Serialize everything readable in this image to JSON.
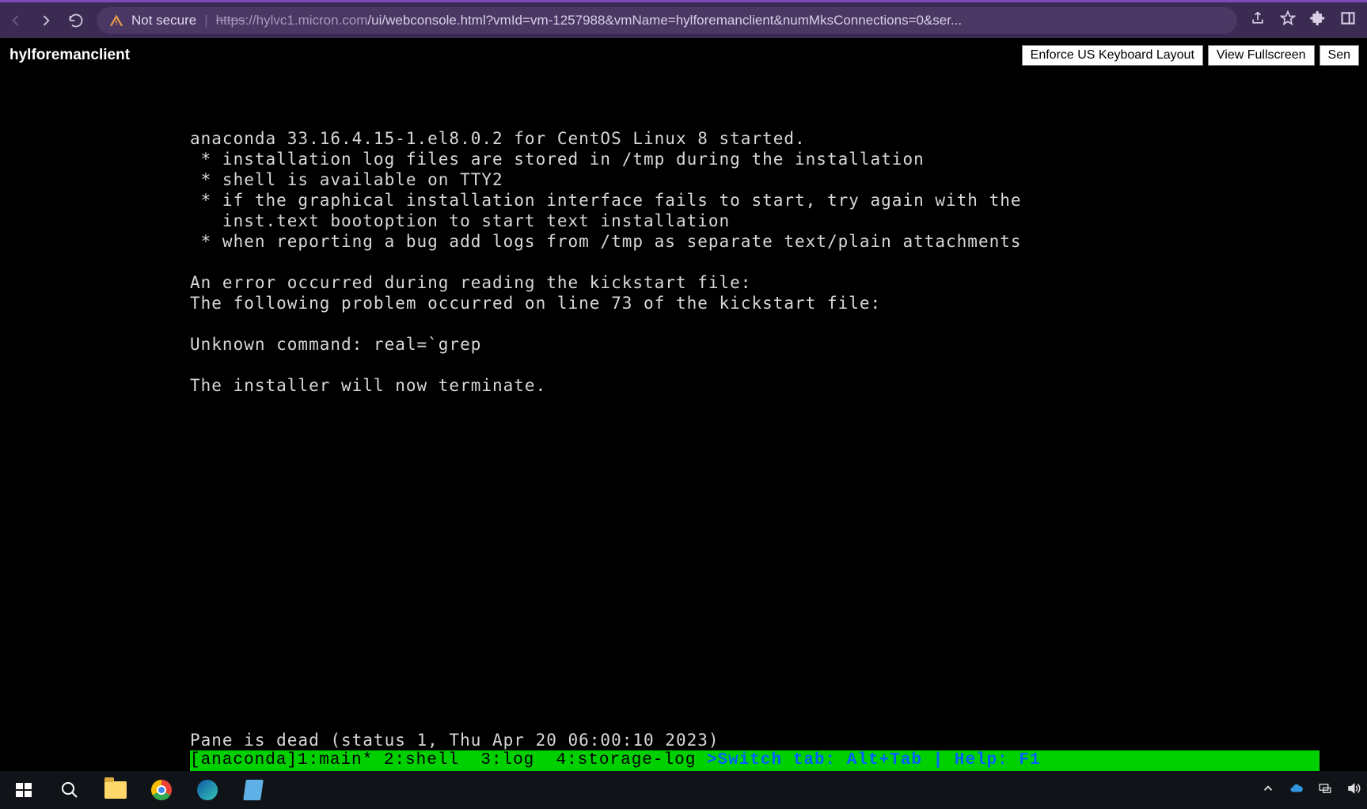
{
  "browser": {
    "not_secure": "Not secure",
    "url_proto": "https",
    "url_sep": "://",
    "url_host_dim": "hylvc1.micron.com",
    "url_path": "/ui/webconsole.html?vmId=vm-1257988&vmName=hylforemanclient&numMksConnections=0&ser..."
  },
  "page": {
    "title": "hylforemanclient",
    "buttons": {
      "kbd": "Enforce US Keyboard Layout",
      "fs": "View Fullscreen",
      "send": "Sen"
    }
  },
  "console": {
    "lines": [
      "anaconda 33.16.4.15-1.el8.0.2 for CentOS Linux 8 started.",
      " * installation log files are stored in /tmp during the installation",
      " * shell is available on TTY2",
      " * if the graphical installation interface fails to start, try again with the",
      "   inst.text bootoption to start text installation",
      " * when reporting a bug add logs from /tmp as separate text/plain attachments",
      "",
      "An error occurred during reading the kickstart file:",
      "The following problem occurred on line 73 of the kickstart file:",
      "",
      "Unknown command: real=`grep",
      "",
      "The installer will now terminate."
    ],
    "pane_dead": "Pane is dead (status 1, Thu Apr 20 06:00:10 2023)",
    "tmux": {
      "session": "[anaconda]",
      "tabs": "1:main* 2:shell  3:log  4:storage-log ",
      "hint": ">Switch tab: Alt+Tab | Help: F1 "
    }
  }
}
